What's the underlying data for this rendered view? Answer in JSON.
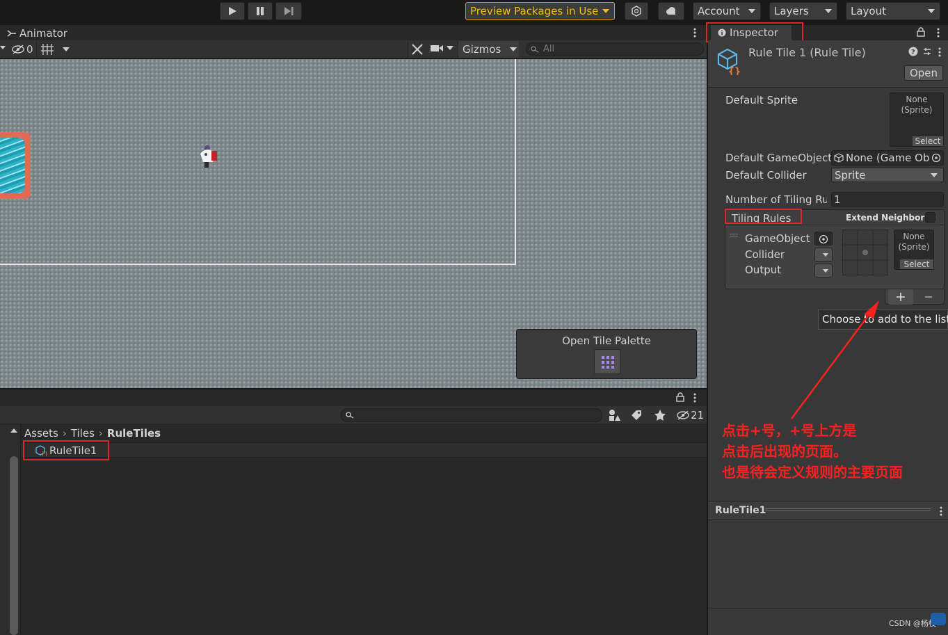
{
  "toolbar": {
    "preview_packages": "Preview Packages in Use",
    "account": "Account",
    "layers": "Layers",
    "layout": "Layout"
  },
  "scene": {
    "tab_title": "Animator",
    "hidden_count": "0",
    "gizmos": "Gizmos",
    "search_placeholder": "All",
    "tile_palette_label": "Open Tile Palette"
  },
  "project": {
    "hidden_count": "21",
    "breadcrumb": [
      "Assets",
      "Tiles",
      "RuleTiles"
    ],
    "items": [
      {
        "label": "RuleTile1"
      }
    ]
  },
  "inspector": {
    "tab_title": "Inspector",
    "asset_title": "Rule Tile 1 (Rule Tile)",
    "open_button": "Open",
    "default_sprite_label": "Default Sprite",
    "sprite_none": "None",
    "sprite_type": "(Sprite)",
    "select_label": "Select",
    "default_gameobject_label": "Default GameObject",
    "default_gameobject_value": "None (Game Obj",
    "default_collider_label": "Default Collider",
    "default_collider_value": "Sprite",
    "num_tiling_rules_label": "Number of Tiling Rul",
    "num_tiling_rules_value": "1",
    "tiling_rules_label": "Tiling Rules",
    "extend_neighbor_label": "Extend Neighbor",
    "rule": {
      "gameobject_label": "GameObject",
      "collider_label": "Collider",
      "output_label": "Output",
      "sprite_none": "None",
      "sprite_type": "(Sprite)",
      "select_label": "Select"
    },
    "tooltip": "Choose to add to the list",
    "preview_title": "RuleTile1"
  },
  "annotation": {
    "line1": "点击+号，+号上方是",
    "line2": "点击后出现的页面。",
    "line3": "也是待会定义规则的主要页面"
  },
  "watermark": "CSDN @杨枝",
  "colors": {
    "accent_red": "#e0242b",
    "preview_packages": "#f0c000"
  }
}
